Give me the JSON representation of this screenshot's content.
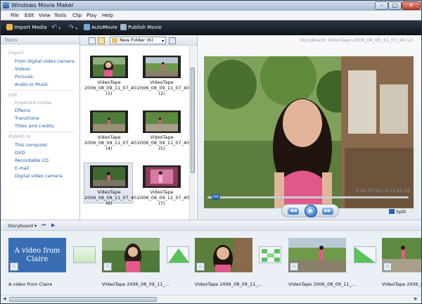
{
  "window": {
    "title": "Windows Movie Maker"
  },
  "menu": [
    "File",
    "Edit",
    "View",
    "Tools",
    "Clip",
    "Play",
    "Help"
  ],
  "toolbar": {
    "import_label": "Import Media",
    "automovie_label": "AutoMovie",
    "publish_label": "Publish Movie",
    "undo_icon": "undo-icon",
    "redo_icon": "redo-icon"
  },
  "tasks": {
    "header": "Tasks",
    "sections": [
      {
        "title": "Import",
        "items": [
          {
            "label": "From digital video camera",
            "enabled": true
          },
          {
            "label": "Videos",
            "enabled": true
          },
          {
            "label": "Pictures",
            "enabled": true
          },
          {
            "label": "Audio or Music",
            "enabled": true
          }
        ]
      },
      {
        "title": "Edit",
        "items": [
          {
            "label": "Imported media",
            "enabled": false
          },
          {
            "label": "Effects",
            "enabled": true
          },
          {
            "label": "Transitions",
            "enabled": true
          },
          {
            "label": "Titles and credits",
            "enabled": true
          }
        ]
      },
      {
        "title": "Publish to",
        "items": [
          {
            "label": "This computer",
            "enabled": true
          },
          {
            "label": "DVD",
            "enabled": true
          },
          {
            "label": "Recordable CD",
            "enabled": true
          },
          {
            "label": "E-mail",
            "enabled": true
          },
          {
            "label": "Digital video camera",
            "enabled": true
          }
        ]
      }
    ]
  },
  "collection": {
    "folder": "New Folder (6)",
    "clips": [
      {
        "line1": "VideoTape",
        "line2": "2006_08_09_11_07_40 (1)",
        "selected": false
      },
      {
        "line1": "VideoTape",
        "line2": "2006_08_09_11_07_40 (2)",
        "selected": false
      },
      {
        "line1": "VideoTape",
        "line2": "2006_08_09_11_07_40 (4)",
        "selected": false
      },
      {
        "line1": "VideoTape",
        "line2": "2006_08_09_11_07_40 (5)",
        "selected": false
      },
      {
        "line1": "VideoTape",
        "line2": "2006_08_09_11_07_40 (6)",
        "selected": true
      },
      {
        "line1": "VideoTape",
        "line2": "2006_08_09_11_07_40 (7)",
        "selected": false
      }
    ]
  },
  "preview": {
    "title": "Storyboard: VideoTape 2006_08_09_11_07_40 (2)",
    "time": "0:00:07.93 / 0:12:05.55",
    "split_label": "Split",
    "progress_fraction": 0.03
  },
  "storyboard": {
    "label": "Storyboard",
    "items": [
      {
        "type": "title",
        "text": "A video from Claire",
        "caption": "A video from Claire"
      },
      {
        "type": "clip",
        "caption": "VideoTape 2006_08_09_11_..."
      },
      {
        "type": "clip",
        "caption": "VideoTape 2006_08_09_11_..."
      },
      {
        "type": "clip",
        "caption": "VideoTape 2006_08_09_11_..."
      },
      {
        "type": "clip",
        "caption": "VideoTape 2006_08_..."
      }
    ]
  }
}
